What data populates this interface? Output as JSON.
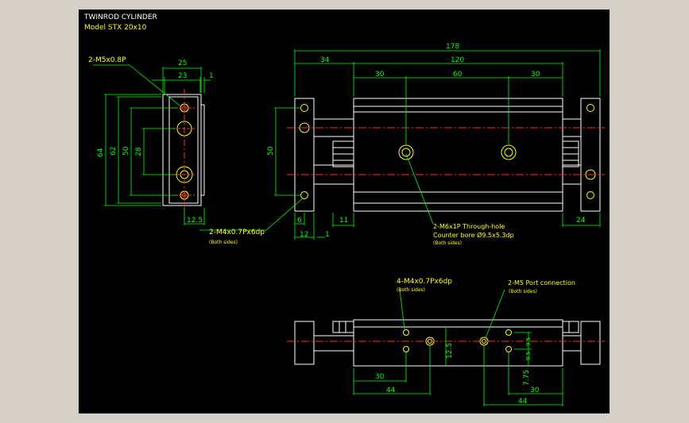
{
  "title": {
    "line1": "TWINROD CYLINDER",
    "line2": "Model STX 20x10"
  },
  "colors": {
    "background": "#000000",
    "frame": "#d4d0c8",
    "outline": "#ffffff",
    "dimension": "#00ff00",
    "centerline": "#ff2a2a",
    "hole": "#ffff00",
    "text_title": "#ffffff",
    "text_model": "#ffff00"
  },
  "side_view": {
    "top_dims": [
      "25",
      "23",
      "1"
    ],
    "left_dims": [
      "64",
      "62",
      "50",
      "28"
    ],
    "bottom_dims": [
      "12.5"
    ],
    "callout_top": "2-M5x0.8P"
  },
  "front_view": {
    "top_dims": [
      "178",
      "34",
      "120",
      "30",
      "60",
      "30"
    ],
    "left_dim": "50",
    "bottom_dims": [
      "6",
      "11",
      "12",
      "1",
      "24"
    ],
    "callout_left": "2-M4x0.7Px6dp",
    "callout_left_note": "(Both sides)",
    "callout_center": "2-M6x1P Through-hole",
    "callout_center_2": "Counter bore Ø9.5x5.3dp",
    "callout_center_note": "(Both sides)"
  },
  "bottom_view": {
    "callout_left": "4-M4x0.7Px6dp",
    "callout_left_note": "(Both sides)",
    "callout_right": "2-M5 Port connection",
    "callout_right_note": "(Both sides)",
    "dims": [
      "30",
      "44",
      "12.5",
      "9.5",
      "9.5",
      "7.75",
      "30",
      "44"
    ]
  }
}
